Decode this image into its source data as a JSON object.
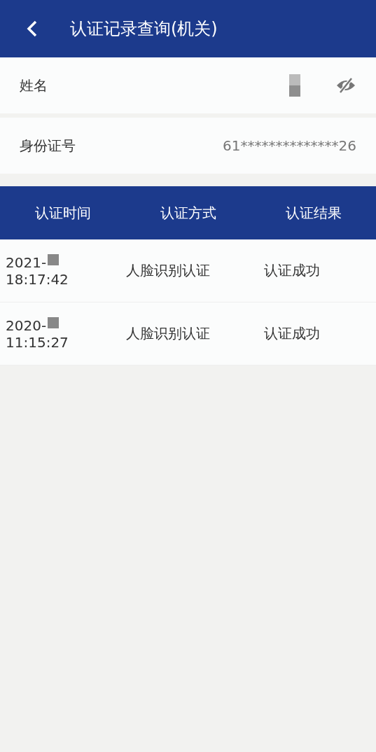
{
  "header": {
    "title": "认证记录查询(机关)"
  },
  "fields": [
    {
      "kind": "masked",
      "label": "姓名"
    },
    {
      "kind": "text",
      "label": "身份证号",
      "value": "61**************26"
    }
  ],
  "table": {
    "columns": [
      "认证时间",
      "认证方式",
      "认证结果"
    ],
    "rows": [
      {
        "date": "2021-",
        "time": "18:17:42",
        "method": "人脸识别认证",
        "result": "认证成功"
      },
      {
        "date": "2020-",
        "time": "11:15:27",
        "method": "人脸识别认证",
        "result": "认证成功"
      }
    ]
  }
}
